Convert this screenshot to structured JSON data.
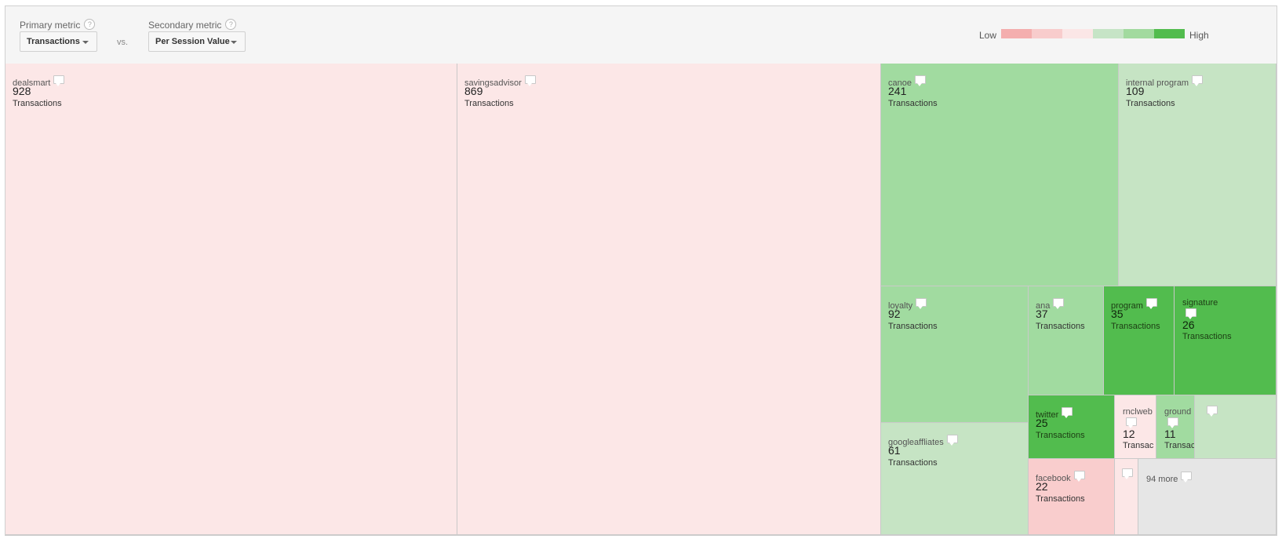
{
  "header": {
    "primary_label": "Primary metric",
    "primary_value": "Transactions",
    "vs": "vs.",
    "secondary_label": "Secondary metric",
    "secondary_value": "Per Session Value",
    "help_glyph": "?",
    "legend_low": "Low",
    "legend_high": "High",
    "legend_colors": [
      "#f4aeae",
      "#f8cccc",
      "#fbe6e6",
      "#c6e4c6",
      "#a2da9f",
      "#52bc4e"
    ]
  },
  "unit": "Transactions",
  "colors": {
    "light_pink": "#fce7e7",
    "pink": "#f9cdcd",
    "pale_green": "#c6e4c4",
    "green": "#a1dba0",
    "dark_green": "#52bc4e",
    "gray": "#e6e6e6"
  },
  "cells": [
    {
      "name": "dealsmart",
      "value": 928
    },
    {
      "name": "savingsadvisor",
      "value": 869
    },
    {
      "name": "canoe",
      "value": 241
    },
    {
      "name": "internal program",
      "value": 109
    },
    {
      "name": "loyalty",
      "value": 92
    },
    {
      "name": "ana",
      "value": 37
    },
    {
      "name": "program",
      "value": 35
    },
    {
      "name": "signature",
      "value": 26
    },
    {
      "name": "googleaffliates",
      "value": 61
    },
    {
      "name": "twitter",
      "value": 25
    },
    {
      "name": "rnclweb",
      "value": 12,
      "unit_shown": "Transac"
    },
    {
      "name": "ground",
      "value": 11,
      "unit_shown": "Transac"
    },
    {
      "name": "facebook",
      "value": 22
    },
    {
      "more_label": "94 more"
    }
  ]
}
